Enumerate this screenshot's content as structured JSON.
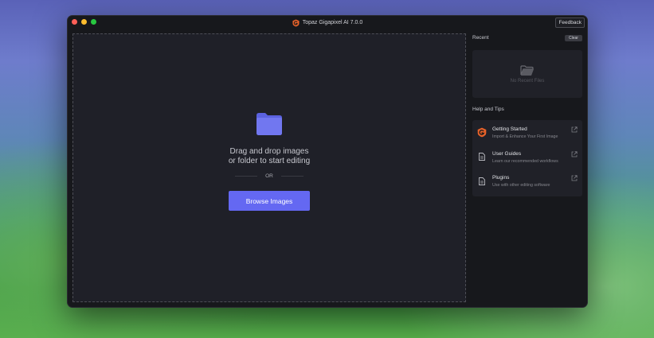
{
  "window": {
    "title": "Topaz Gigapixel AI 7.0.0",
    "feedback_label": "Feedback"
  },
  "dropzone": {
    "instruction": "Drag and drop images or folder to start editing",
    "or_label": "OR",
    "browse_label": "Browse Images",
    "accent_color": "#6468f2"
  },
  "sidebar": {
    "recent": {
      "title": "Recent",
      "clear_label": "Clear",
      "empty_label": "No Recent Files"
    },
    "help": {
      "title": "Help and Tips",
      "items": [
        {
          "label": "Getting Started",
          "description": "Import & Enhance Your First Image",
          "icon": "topaz-logo-icon"
        },
        {
          "label": "User Guides",
          "description": "Learn our recommended workflows",
          "icon": "document-icon"
        },
        {
          "label": "Plugins",
          "description": "Use with other editing software",
          "icon": "document-icon"
        }
      ]
    }
  }
}
